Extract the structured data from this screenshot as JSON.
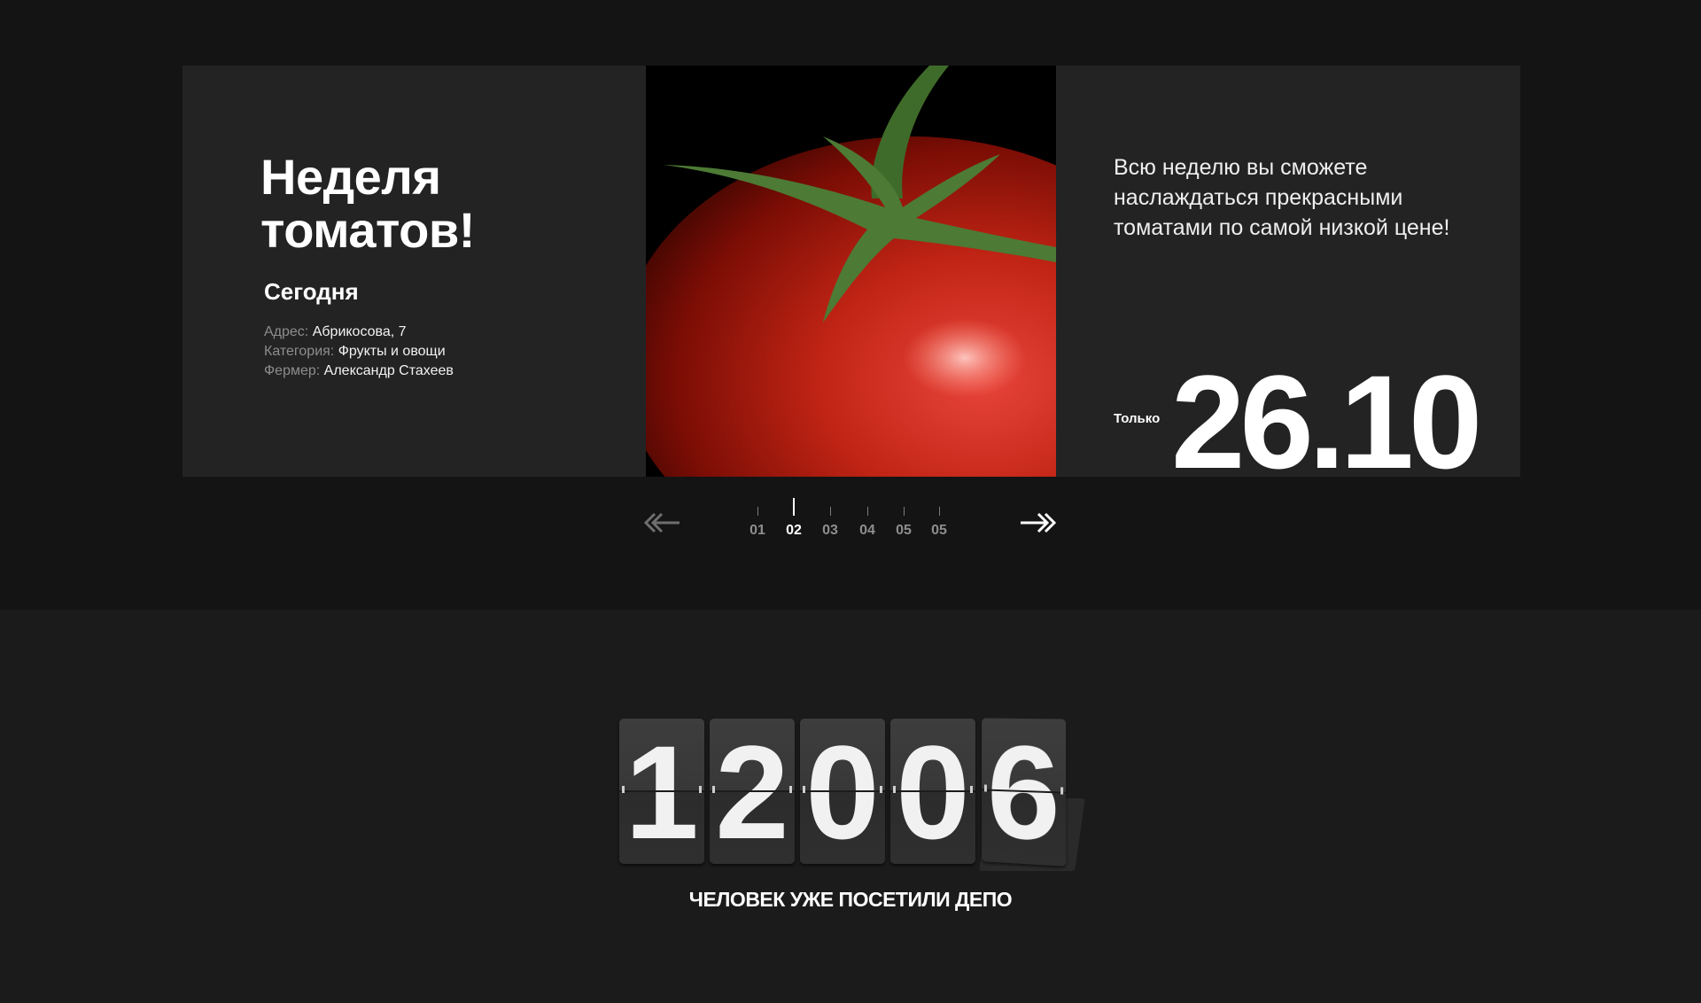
{
  "promo": {
    "title_line1": "Неделя",
    "title_line2": "томатов!",
    "when": "Сегодня",
    "address_label": "Адрес:",
    "address_value": "Абрикосова, 7",
    "category_label": "Категория:",
    "category_value": "Фрукты и овощи",
    "farmer_label": "Фермер:",
    "farmer_value": "Александр Стахеев",
    "description": "Всю неделю вы сможете наслаждаться прекрасными томатами по самой низкой цене!",
    "price_label": "Только",
    "price": "26.10"
  },
  "pager": {
    "prev_icon": "double-arrow-left-icon",
    "next_icon": "double-arrow-right-icon",
    "pages": [
      "01",
      "02",
      "03",
      "04",
      "05",
      "05"
    ],
    "active_index": 1
  },
  "counter": {
    "digits": [
      "1",
      "2",
      "0",
      "0",
      "6"
    ],
    "caption": "ЧЕЛОВЕК УЖЕ ПОСЕТИЛИ ДЕПО"
  },
  "colors": {
    "page_bg": "#141414",
    "panel_bg": "#232323",
    "text": "#ffffff",
    "muted": "#8d8d8d"
  }
}
